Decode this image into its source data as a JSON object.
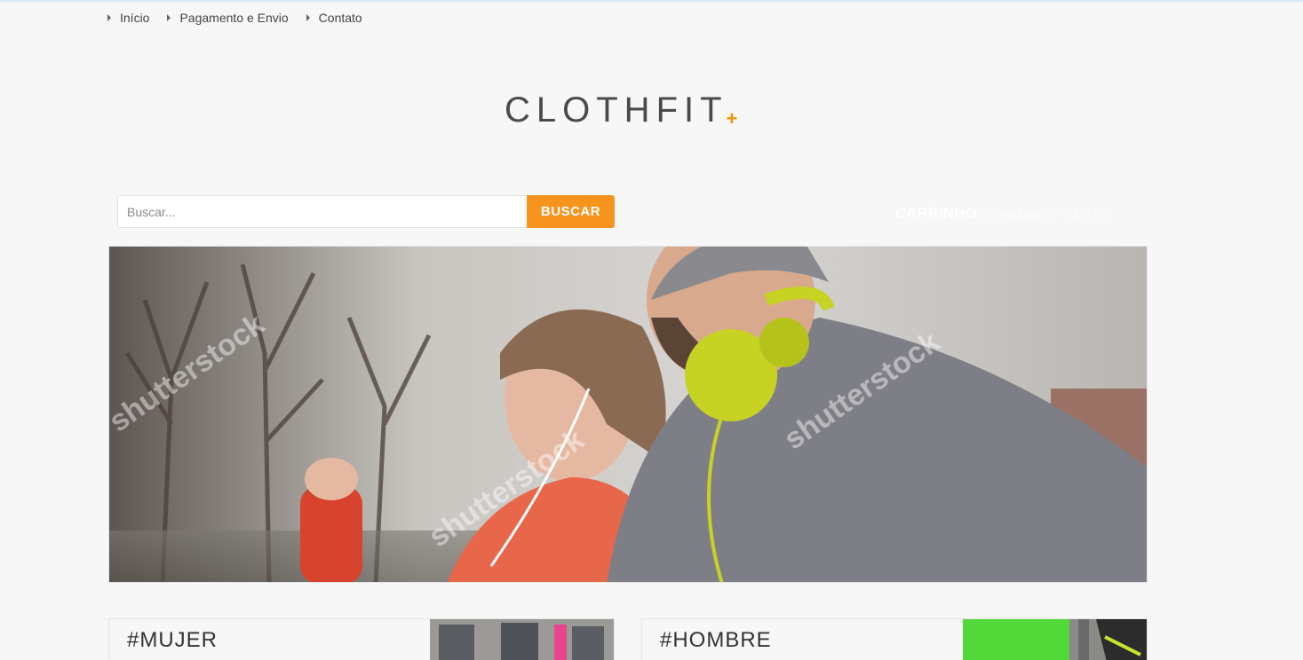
{
  "nav": {
    "items": [
      {
        "label": "Início"
      },
      {
        "label": "Pagamento e Envio"
      },
      {
        "label": "Contato"
      }
    ]
  },
  "brand": {
    "name": "CLOTHFIT",
    "mark": "+",
    "accent_color": "#f39200"
  },
  "search": {
    "placeholder": "Buscar...",
    "value": "",
    "button_label": "BUSCAR",
    "button_color": "#f7941d"
  },
  "cart": {
    "label": "CARRINHO:",
    "summary": "0 produto(s) - R$ 0,00"
  },
  "hero": {
    "watermark": "shutterstock"
  },
  "categories": [
    {
      "label": "#MUJER"
    },
    {
      "label": "#HOMBRE"
    }
  ]
}
